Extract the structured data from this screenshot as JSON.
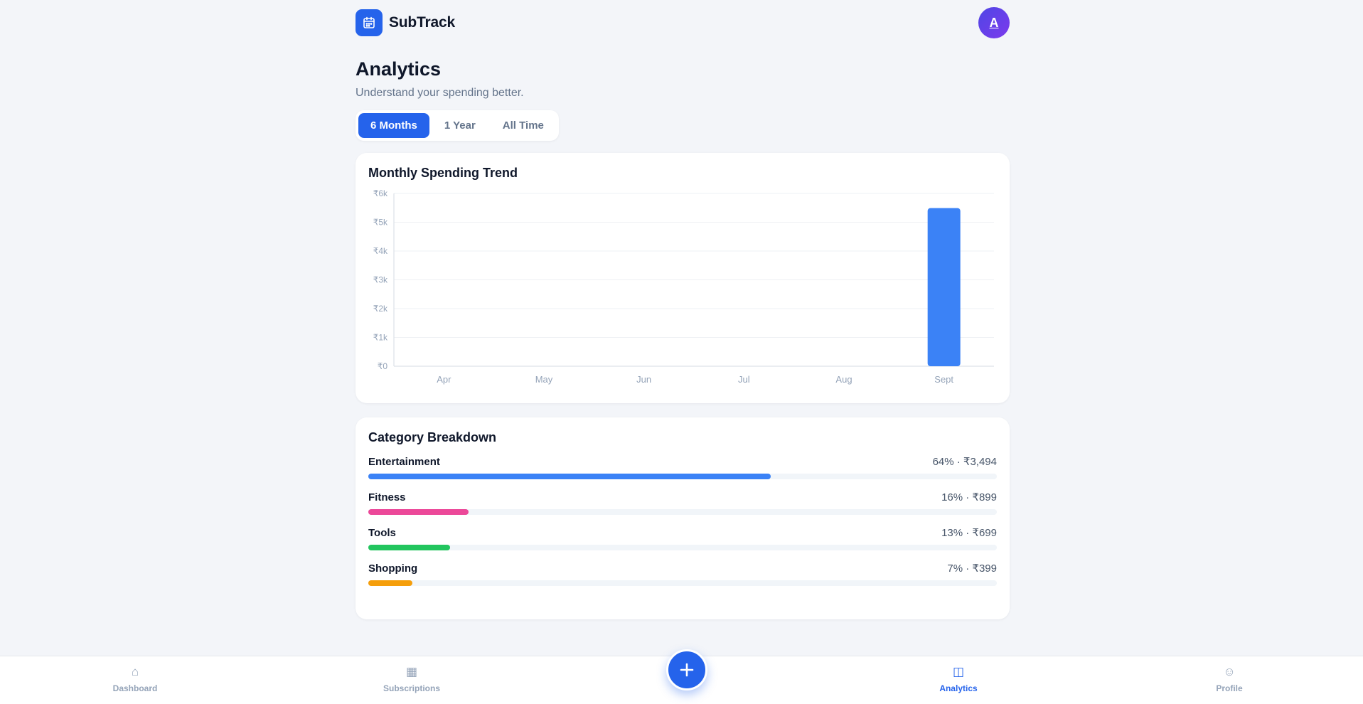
{
  "app": {
    "name": "SubTrack",
    "avatar_initial": "A"
  },
  "page": {
    "title": "Analytics",
    "subtitle": "Understand your spending better."
  },
  "range_tabs": [
    {
      "label": "6 Months",
      "active": true
    },
    {
      "label": "1 Year",
      "active": false
    },
    {
      "label": "All Time",
      "active": false
    }
  ],
  "trend": {
    "title": "Monthly Spending Trend"
  },
  "chart_data": {
    "type": "bar",
    "title": "Monthly Spending Trend",
    "categories": [
      "Apr",
      "May",
      "Jun",
      "Jul",
      "Aug",
      "Sept"
    ],
    "values": [
      0,
      0,
      0,
      0,
      0,
      5491
    ],
    "ylim": [
      0,
      6000
    ],
    "yticks": [
      0,
      1000,
      2000,
      3000,
      4000,
      5000,
      6000
    ],
    "ytick_labels": [
      "₹0",
      "₹1k",
      "₹2k",
      "₹3k",
      "₹4k",
      "₹5k",
      "₹6k"
    ],
    "xlabel": "",
    "ylabel": "",
    "grid": true,
    "bar_color": "#3b82f6"
  },
  "breakdown": {
    "title": "Category Breakdown",
    "items": [
      {
        "name": "Entertainment",
        "value": "64% · ₹3,494",
        "percent": 64,
        "color": "#3b82f6"
      },
      {
        "name": "Fitness",
        "value": "16% · ₹899",
        "percent": 16,
        "color": "#ec4899"
      },
      {
        "name": "Tools",
        "value": "13% · ₹699",
        "percent": 13,
        "color": "#22c55e"
      },
      {
        "name": "Shopping",
        "value": "7% · ₹399",
        "percent": 7,
        "color": "#f59e0b"
      }
    ]
  },
  "nav": {
    "items": [
      {
        "label": "Dashboard",
        "icon": "home-icon",
        "glyph": "⌂",
        "active": false
      },
      {
        "label": "Subscriptions",
        "icon": "grid-icon",
        "glyph": "▦",
        "active": false
      },
      {
        "label": "Analytics",
        "icon": "columns-icon",
        "glyph": "◫",
        "active": true
      },
      {
        "label": "Profile",
        "icon": "smile-icon",
        "glyph": "☺",
        "active": false
      }
    ],
    "fab_icon": "plus-icon"
  }
}
